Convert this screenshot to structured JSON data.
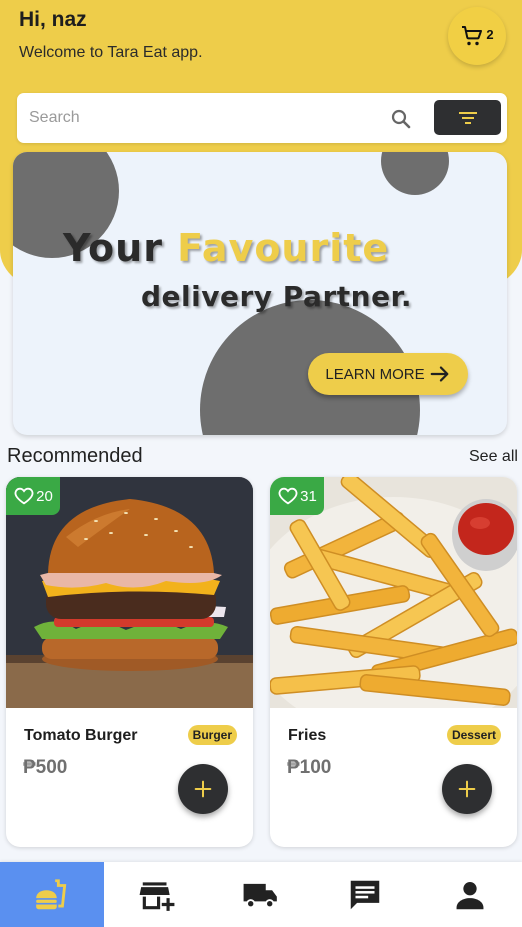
{
  "header": {
    "greeting": "Hi, naz",
    "welcome": "Welcome to Tara Eat app.",
    "cart_icon": "cart-icon",
    "cart_count": "2"
  },
  "search": {
    "placeholder": "Search",
    "icon": "search-icon",
    "filter_icon": "filter-icon"
  },
  "banner": {
    "line1_part1": "Your ",
    "line1_accent": "Favourite",
    "line2": "delivery Partner.",
    "button_label": "LEARN MORE",
    "button_icon": "arrow-right-icon"
  },
  "recommended": {
    "title": "Recommended",
    "see_all": "See all",
    "items": [
      {
        "likes": "20",
        "name": "Tomato Burger",
        "category": "Burger",
        "price": "₱500",
        "image": "burger-photo"
      },
      {
        "likes": "31",
        "name": "Fries",
        "category": "Dessert",
        "price": "₱100",
        "image": "fries-photo"
      }
    ]
  },
  "bottom_nav": [
    {
      "icon": "fastfood-icon",
      "active": true
    },
    {
      "icon": "store-add-icon",
      "active": false
    },
    {
      "icon": "truck-icon",
      "active": false
    },
    {
      "icon": "chat-icon",
      "active": false
    },
    {
      "icon": "person-icon",
      "active": false
    }
  ],
  "colors": {
    "primary_yellow": "#eecd4a",
    "dark": "#2e2f31",
    "like_green": "#3aa945",
    "nav_active": "#5a90f0"
  }
}
